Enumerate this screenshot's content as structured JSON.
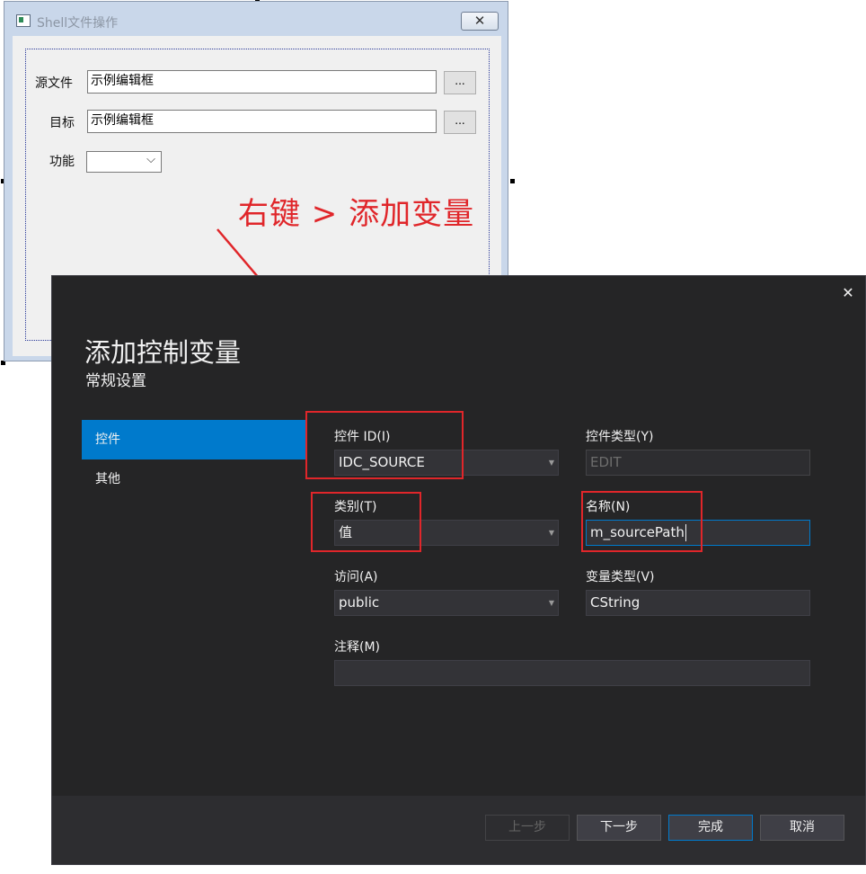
{
  "annotation": {
    "text": "右键 > 添加变量"
  },
  "shell_dialog": {
    "title": "Shell文件操作",
    "close_glyph": "✕",
    "source_label": "源文件",
    "source_value": "示例编辑框",
    "target_label": "目标",
    "target_value": "示例编辑框",
    "browse_label": "...",
    "function_label": "功能",
    "combo_chevron": "⌵"
  },
  "add_var_dialog": {
    "close_glyph": "✕",
    "heading": "添加控制变量",
    "subheading": "常规设置",
    "nav": [
      {
        "label": "控件",
        "active": true
      },
      {
        "label": "其他",
        "active": false
      }
    ],
    "fields": {
      "control_id": {
        "label": "控件 ID(I)",
        "value": "IDC_SOURCE"
      },
      "control_type": {
        "label": "控件类型(Y)",
        "value": "EDIT"
      },
      "category": {
        "label": "类别(T)",
        "value": "值"
      },
      "name": {
        "label": "名称(N)",
        "value": "m_sourcePath"
      },
      "access": {
        "label": "访问(A)",
        "value": "public"
      },
      "var_type": {
        "label": "变量类型(V)",
        "value": "CString"
      },
      "comment": {
        "label": "注释(M)",
        "value": ""
      }
    },
    "dropdown_glyph": "▼",
    "buttons": {
      "prev": "上一步",
      "next": "下一步",
      "finish": "完成",
      "cancel": "取消"
    }
  },
  "colors": {
    "accent": "#007acc",
    "annotation_red": "#e0262a",
    "dialog_bg": "#252526"
  }
}
